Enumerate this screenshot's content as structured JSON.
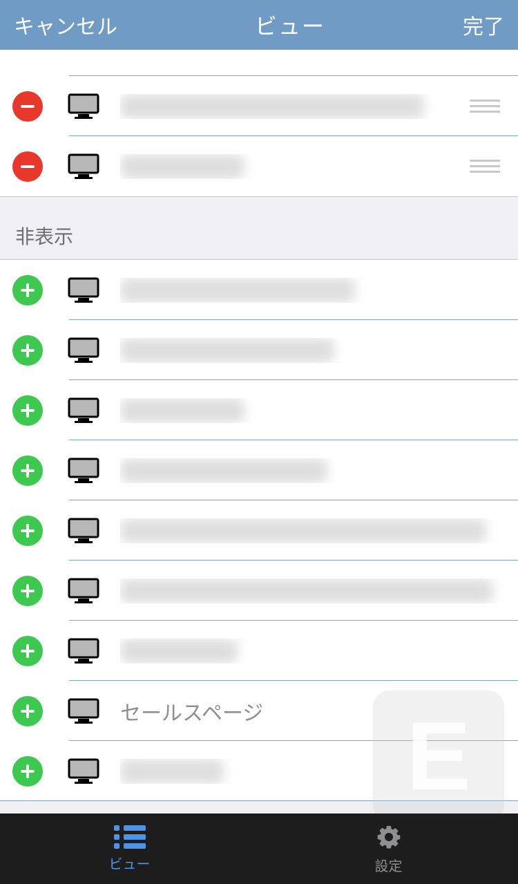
{
  "header": {
    "cancel": "キャンセル",
    "title": "ビュー",
    "done": "完了"
  },
  "visible_rows": [
    {
      "label": ""
    },
    {
      "label": ""
    },
    {
      "label": ""
    }
  ],
  "hidden_section_title": "非表示",
  "hidden_rows": [
    {
      "label": ""
    },
    {
      "label": ""
    },
    {
      "label": ""
    },
    {
      "label": ""
    },
    {
      "label": ""
    },
    {
      "label": ""
    },
    {
      "label": ""
    },
    {
      "label": "セールスページ"
    },
    {
      "label": ""
    }
  ],
  "tabs": {
    "view": "ビュー",
    "settings": "設定"
  },
  "watermark": "E"
}
